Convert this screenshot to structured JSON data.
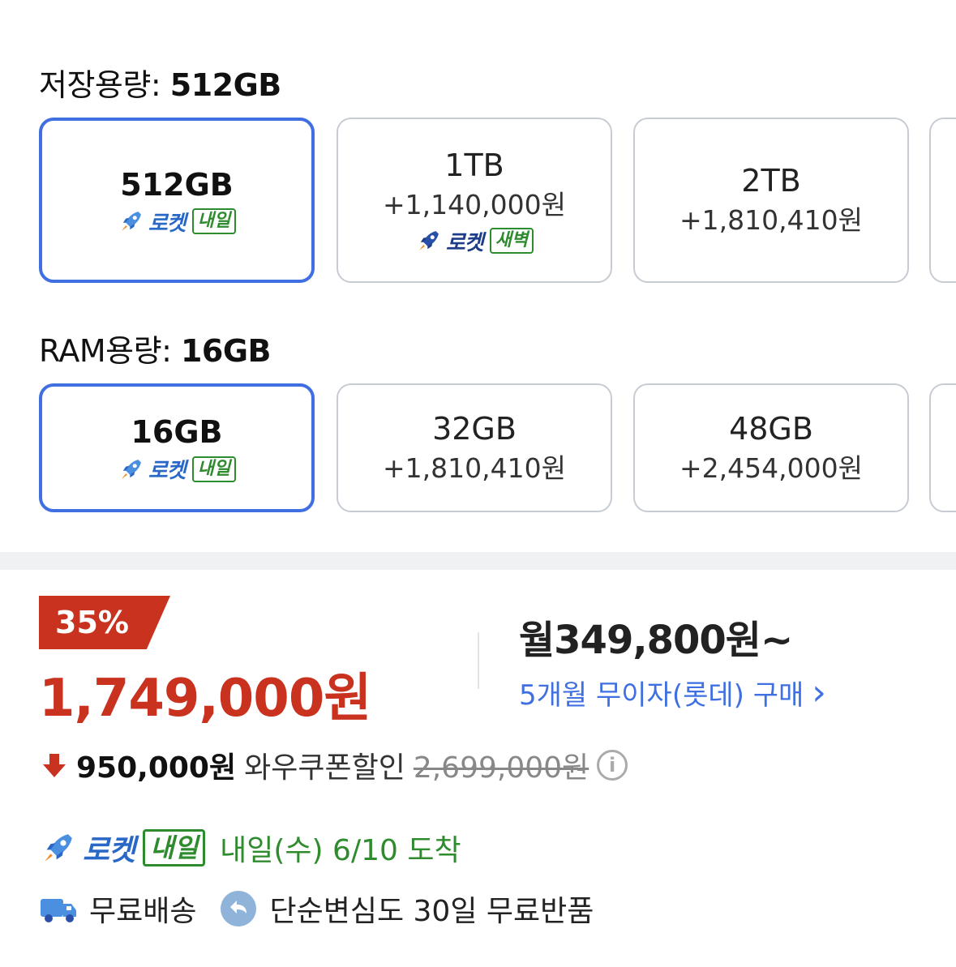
{
  "storage": {
    "label_prefix": "저장용량:",
    "selected_value": "512GB",
    "options": [
      {
        "name": "512GB",
        "price": "",
        "badge_text": "로켓",
        "badge_tag": "내일",
        "selected": true
      },
      {
        "name": "1TB",
        "price": "+1,140,000원",
        "badge_text": "로켓",
        "badge_tag": "새벽",
        "selected": false
      },
      {
        "name": "2TB",
        "price": "+1,810,410원",
        "badge_text": "",
        "badge_tag": "",
        "selected": false
      }
    ]
  },
  "ram": {
    "label_prefix": "RAM용량:",
    "selected_value": "16GB",
    "options": [
      {
        "name": "16GB",
        "price": "",
        "badge_text": "로켓",
        "badge_tag": "내일",
        "selected": true
      },
      {
        "name": "32GB",
        "price": "+1,810,410원",
        "badge_text": "",
        "badge_tag": "",
        "selected": false
      },
      {
        "name": "48GB",
        "price": "+2,454,000원",
        "badge_text": "",
        "badge_tag": "",
        "selected": false
      }
    ]
  },
  "pricing": {
    "discount_rate": "35%",
    "sale_price": "1,749,000원",
    "monthly_price": "월349,800원~",
    "installment_text": "5개월 무이자(롯데) 구매",
    "installment_chevron": "›",
    "coupon_amount": "950,000원",
    "coupon_label": "와우쿠폰할인",
    "original_price": "2,699,000원",
    "info_glyph": "i"
  },
  "delivery": {
    "badge_text": "로켓",
    "badge_tag": "내일",
    "arrival_text": "내일(수) 6/10 도착",
    "free_shipping": "무료배송",
    "free_return": "단순변심도 30일 무료반품"
  },
  "colors": {
    "accent_blue": "#3f6fe0",
    "sale_red": "#c8321f",
    "rocket_blue": "#2a68c8",
    "rocket_green": "#2e8b2e"
  },
  "icons": [
    "rocket-icon",
    "down-arrow-icon",
    "info-icon",
    "truck-icon",
    "return-icon",
    "chevron-right-icon"
  ]
}
